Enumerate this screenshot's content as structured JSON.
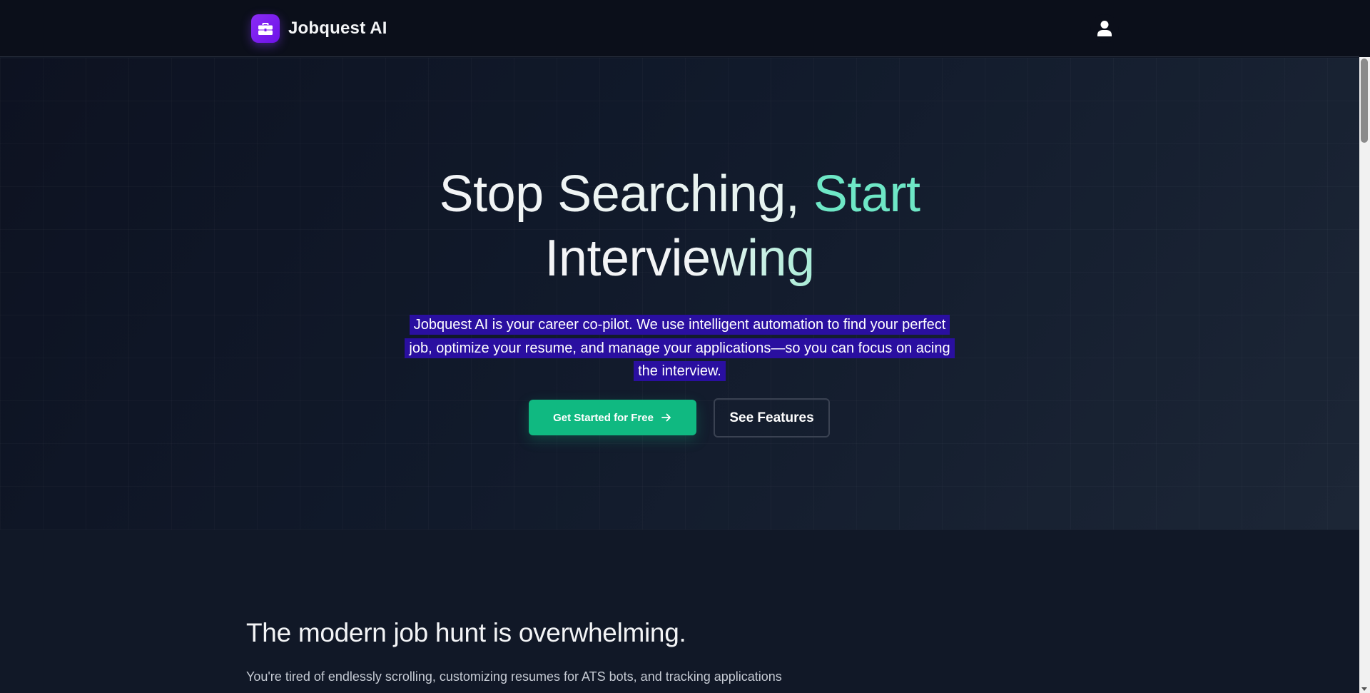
{
  "header": {
    "brand_name": "Jobquest AI",
    "logo_icon": "briefcase-icon",
    "user_icon": "user-icon"
  },
  "hero": {
    "title_part1": "Stop Searching, ",
    "title_accent": "Start",
    "title_line2": "Interviewing",
    "description": "Jobquest AI is your career co-pilot. We use intelligent automation to find your perfect job, optimize your resume, and manage your applications—so you can focus on acing the interview.",
    "primary_cta": "Get Started for Free",
    "primary_cta_icon": "arrow-right-icon",
    "secondary_cta": "See Features"
  },
  "problem_section": {
    "title": "The modern job hunt is overwhelming.",
    "text": "You're tired of endlessly scrolling, customizing resumes for ATS bots, and tracking applications in a spreadsheet. There's a smarter way."
  },
  "colors": {
    "brand_purple": "#7c1aef",
    "accent_green": "#10b981",
    "title_accent": "#6ee7c6",
    "highlight": "#2a0fa0",
    "background": "#111827"
  }
}
